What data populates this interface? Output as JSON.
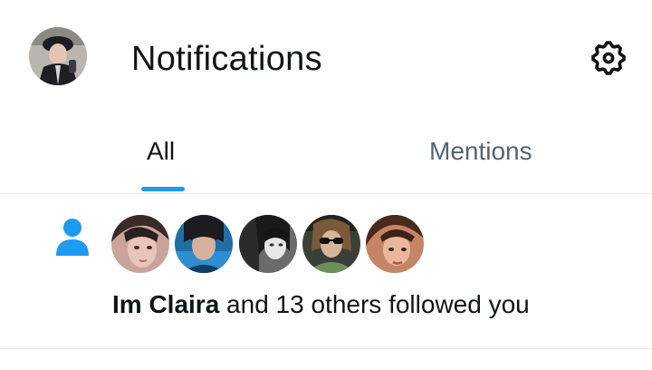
{
  "header": {
    "title": "Notifications",
    "profile_avatar": "user-avatar",
    "settings_icon": "gear-icon"
  },
  "tabs": [
    {
      "label": "All",
      "selected": true
    },
    {
      "label": "Mentions",
      "selected": false
    }
  ],
  "notifications": [
    {
      "type": "follow",
      "icon": "person-icon",
      "follower_avatars": [
        "avatar-1",
        "avatar-2",
        "avatar-3",
        "avatar-4",
        "avatar-5"
      ],
      "name": "Im Claira",
      "message": " and 13 others followed you"
    }
  ],
  "colors": {
    "accent": "#1d9bf0",
    "text_primary": "#0f1419",
    "text_secondary": "#536471",
    "divider": "#e1e4e7"
  }
}
